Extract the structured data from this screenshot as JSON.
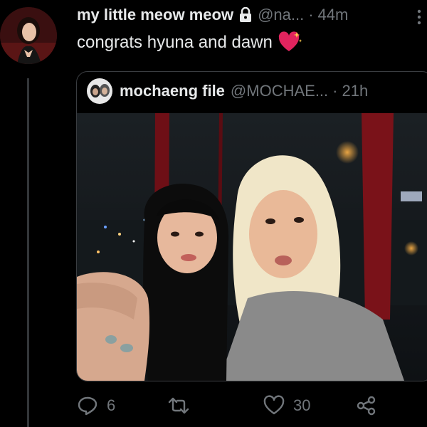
{
  "tweet": {
    "display_name": "my little meow meow",
    "handle": "@na...",
    "separator": "·",
    "time": "44m",
    "text": "congrats hyuna and dawn"
  },
  "quote": {
    "display_name": "mochaeng file",
    "handle": "@MOCHAE...",
    "separator": "·",
    "time": "21h"
  },
  "actions": {
    "replies": "6",
    "retweets": "",
    "likes": "30"
  },
  "icons": [
    "lock-icon",
    "more-icon",
    "sparkling-heart-emoji",
    "reply-icon",
    "retweet-icon",
    "like-icon",
    "share-icon"
  ],
  "colors": {
    "background": "#000000",
    "text": "#e7e9ea",
    "secondary": "#71767b",
    "heart": "#e0245e"
  }
}
